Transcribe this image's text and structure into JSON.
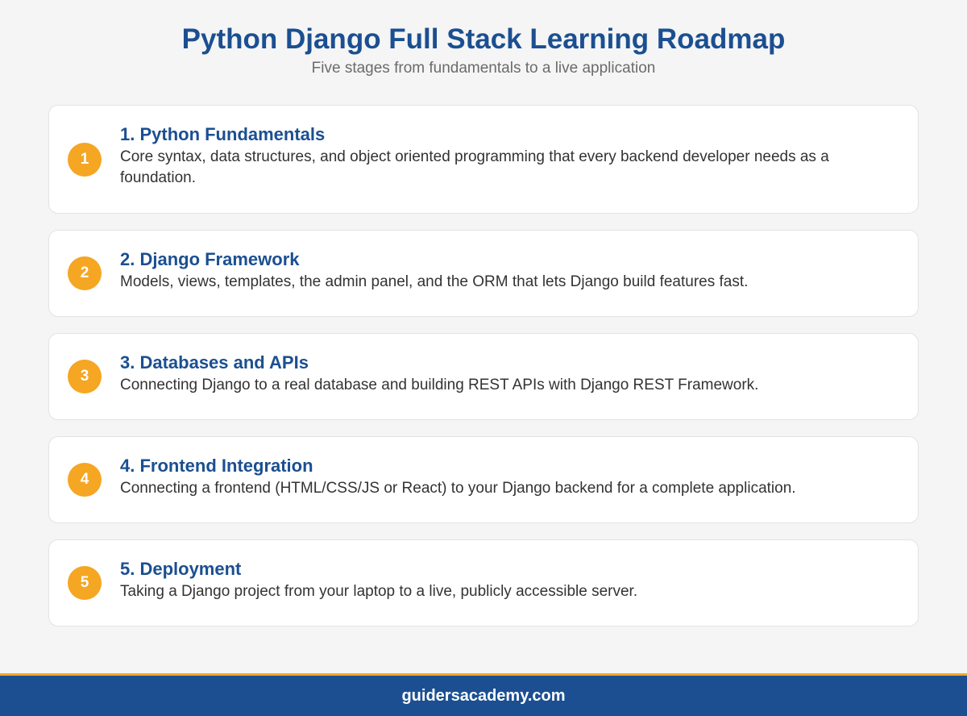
{
  "header": {
    "title": "Python Django Full Stack Learning Roadmap",
    "subtitle": "Five stages from fundamentals to a live application"
  },
  "stages": [
    {
      "number": "1",
      "title": "1. Python Fundamentals",
      "description": "Core syntax, data structures, and object oriented programming that every backend developer needs as a foundation."
    },
    {
      "number": "2",
      "title": "2. Django Framework",
      "description": "Models, views, templates, the admin panel, and the ORM that lets Django build features fast."
    },
    {
      "number": "3",
      "title": "3. Databases and APIs",
      "description": "Connecting Django to a real database and building REST APIs with Django REST Framework."
    },
    {
      "number": "4",
      "title": "4. Frontend Integration",
      "description": "Connecting a frontend (HTML/CSS/JS or React) to your Django backend for a complete application."
    },
    {
      "number": "5",
      "title": "5. Deployment",
      "description": "Taking a Django project from your laptop to a live, publicly accessible server."
    }
  ],
  "footer": {
    "site": "guidersacademy.com"
  },
  "colors": {
    "title": "#1b4f91",
    "badge": "#f5a623",
    "footer_bg": "#1b4f91",
    "footer_border": "#f5a623",
    "background": "#f5f5f5"
  }
}
